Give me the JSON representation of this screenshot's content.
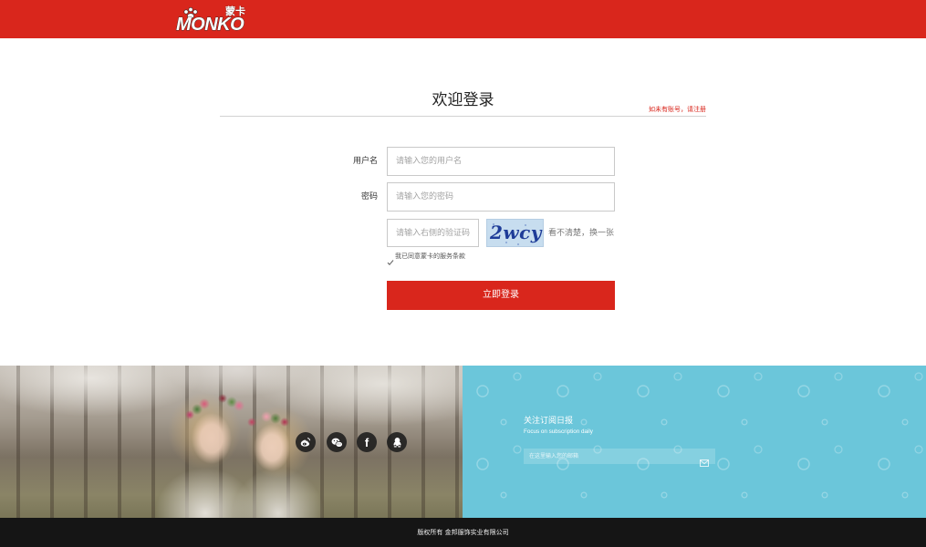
{
  "header": {
    "logo_en": "MONKO",
    "logo_cn": "蒙卡"
  },
  "login": {
    "title": "欢迎登录",
    "register_link": "如未有账号，请注册",
    "username_label": "用户名",
    "username_placeholder": "请输入您的用户名",
    "password_label": "密码",
    "password_placeholder": "请输入您的密码",
    "captcha_placeholder": "请输入右侧的验证码",
    "captcha_text": "2wcy",
    "captcha_refresh": "看不清楚，换一张",
    "agree_text": "我已同意蒙卡的服务条款",
    "agree_checked": true,
    "submit_label": "立即登录"
  },
  "footer": {
    "social_icons": [
      "weibo-icon",
      "wechat-icon",
      "facebook-icon",
      "qq-icon"
    ],
    "subscribe_title": "关注订阅日报",
    "subscribe_subtitle": "Focus on subscription daily",
    "email_placeholder": "在这里输入您的邮箱",
    "copyright": "版权所有 金邦服饰实业有限公司"
  },
  "colors": {
    "brand_red": "#d9261c",
    "subscribe_bg": "#6bc6da",
    "footer_bar": "#151515"
  }
}
